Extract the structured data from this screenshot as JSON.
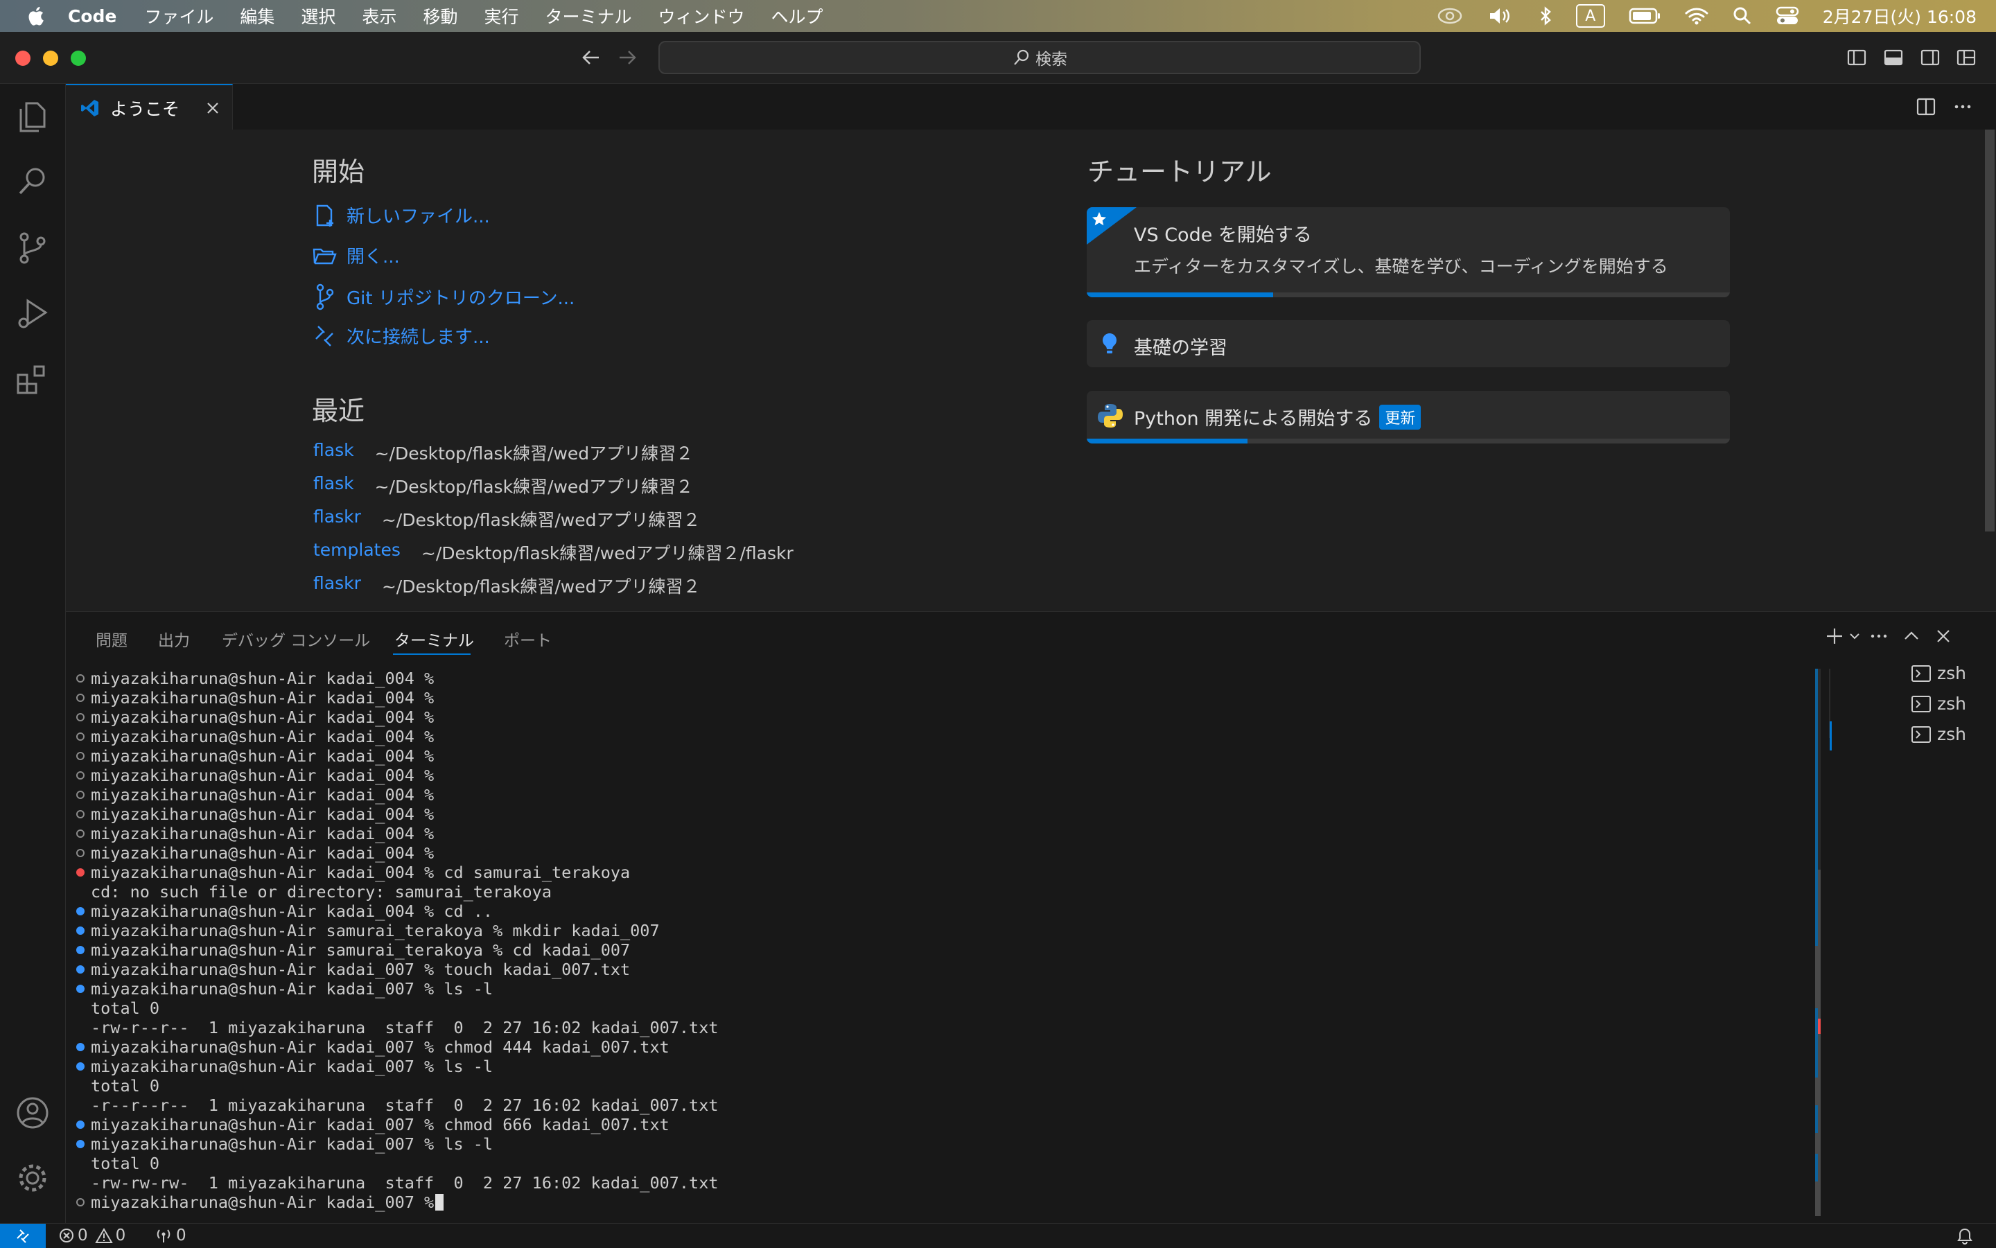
{
  "menubar": {
    "app": "Code",
    "items": [
      "ファイル",
      "編集",
      "選択",
      "表示",
      "移動",
      "実行",
      "ターミナル",
      "ウィンドウ",
      "ヘルプ"
    ],
    "input_indicator": "A",
    "clock": "2月27日(火) 16:08"
  },
  "titlebar": {
    "search_placeholder": "検索"
  },
  "tabs": {
    "welcome": "ようこそ"
  },
  "welcome": {
    "start_heading": "開始",
    "start_items": [
      "新しいファイル...",
      "開く...",
      "Git リポジトリのクローン...",
      "次に接続します..."
    ],
    "recent_heading": "最近",
    "recent": [
      {
        "name": "flask",
        "path": "~/Desktop/flask練習/wedアプリ練習２"
      },
      {
        "name": "flask",
        "path": "~/Desktop/flask練習/wedアプリ練習２"
      },
      {
        "name": "flaskr",
        "path": "~/Desktop/flask練習/wedアプリ練習２"
      },
      {
        "name": "templates",
        "path": "~/Desktop/flask練習/wedアプリ練習２/flaskr"
      },
      {
        "name": "flaskr",
        "path": "~/Desktop/flask練習/wedアプリ練習２"
      }
    ],
    "tutorial_heading": "チュートリアル",
    "tutorials": [
      {
        "title": "VS Code を開始する",
        "description": "エディターをカスタマイズし、基礎を学び、コーディングを開始する",
        "progress": 0.29
      },
      {
        "title": "基礎の学習"
      },
      {
        "title": "Python 開発による開始する",
        "badge": "更新",
        "progress": 0.25
      }
    ]
  },
  "panel": {
    "tabs": [
      "問題",
      "出力",
      "デバッグ コンソール",
      "ターミナル",
      "ポート"
    ],
    "active_tab": "ターミナル",
    "terminal_lines": [
      {
        "mark": "o",
        "text": "miyazakiharuna@shun-Air kadai_004 %"
      },
      {
        "mark": "o",
        "text": "miyazakiharuna@shun-Air kadai_004 %"
      },
      {
        "mark": "o",
        "text": "miyazakiharuna@shun-Air kadai_004 %"
      },
      {
        "mark": "o",
        "text": "miyazakiharuna@shun-Air kadai_004 %"
      },
      {
        "mark": "o",
        "text": "miyazakiharuna@shun-Air kadai_004 %"
      },
      {
        "mark": "o",
        "text": "miyazakiharuna@shun-Air kadai_004 %"
      },
      {
        "mark": "o",
        "text": "miyazakiharuna@shun-Air kadai_004 %"
      },
      {
        "mark": "o",
        "text": "miyazakiharuna@shun-Air kadai_004 %"
      },
      {
        "mark": "o",
        "text": "miyazakiharuna@shun-Air kadai_004 %"
      },
      {
        "mark": "o",
        "text": "miyazakiharuna@shun-Air kadai_004 %"
      },
      {
        "mark": "e",
        "text": "miyazakiharuna@shun-Air kadai_004 % cd samurai_terakoya"
      },
      {
        "mark": "n",
        "text": "cd: no such file or directory: samurai_terakoya"
      },
      {
        "mark": "b",
        "text": "miyazakiharuna@shun-Air kadai_004 % cd .."
      },
      {
        "mark": "b",
        "text": "miyazakiharuna@shun-Air samurai_terakoya % mkdir kadai_007"
      },
      {
        "mark": "b",
        "text": "miyazakiharuna@shun-Air samurai_terakoya % cd kadai_007"
      },
      {
        "mark": "b",
        "text": "miyazakiharuna@shun-Air kadai_007 % touch kadai_007.txt"
      },
      {
        "mark": "b",
        "text": "miyazakiharuna@shun-Air kadai_007 % ls -l"
      },
      {
        "mark": "n",
        "text": "total 0"
      },
      {
        "mark": "n",
        "text": "-rw-r--r--  1 miyazakiharuna  staff  0  2 27 16:02 kadai_007.txt"
      },
      {
        "mark": "b",
        "text": "miyazakiharuna@shun-Air kadai_007 % chmod 444 kadai_007.txt"
      },
      {
        "mark": "b",
        "text": "miyazakiharuna@shun-Air kadai_007 % ls -l"
      },
      {
        "mark": "n",
        "text": "total 0"
      },
      {
        "mark": "n",
        "text": "-r--r--r--  1 miyazakiharuna  staff  0  2 27 16:02 kadai_007.txt"
      },
      {
        "mark": "b",
        "text": "miyazakiharuna@shun-Air kadai_007 % chmod 666 kadai_007.txt"
      },
      {
        "mark": "b",
        "text": "miyazakiharuna@shun-Air kadai_007 % ls -l"
      },
      {
        "mark": "n",
        "text": "total 0"
      },
      {
        "mark": "n",
        "text": "-rw-rw-rw-  1 miyazakiharuna  staff  0  2 27 16:02 kadai_007.txt"
      },
      {
        "mark": "o",
        "text": "miyazakiharuna@shun-Air kadai_007 %",
        "cursor": true
      }
    ],
    "shells": [
      "zsh",
      "zsh",
      "zsh"
    ]
  },
  "status": {
    "errors": "0",
    "warnings": "0",
    "ports": "0"
  },
  "colors": {
    "accent": "#0078d4",
    "link": "#3794ff",
    "error": "#f14c4c"
  }
}
